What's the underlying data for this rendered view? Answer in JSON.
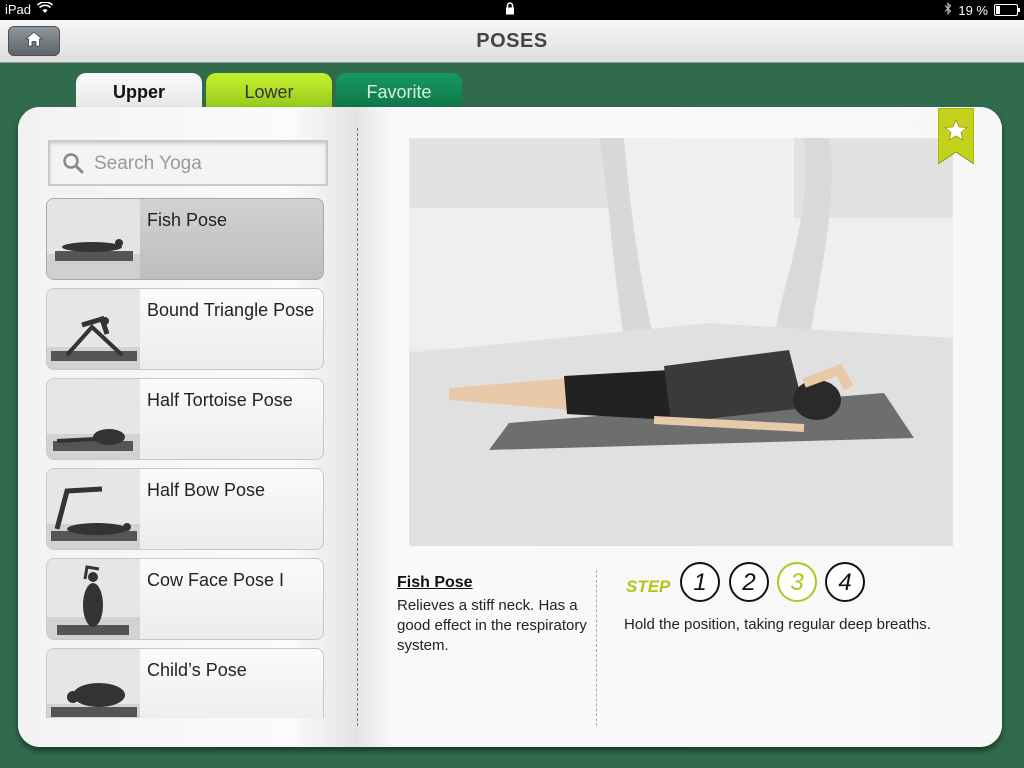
{
  "status_bar": {
    "device": "iPad",
    "battery_percent": "19 %",
    "battery_level": 0.19,
    "icons": [
      "wifi-icon",
      "lock-icon",
      "bluetooth-icon",
      "battery-icon"
    ]
  },
  "nav": {
    "title": "POSES",
    "home_icon": "home-icon"
  },
  "tabs": [
    {
      "label": "Upper",
      "active": true,
      "color": "#f2f2f2"
    },
    {
      "label": "Lower",
      "active": false,
      "color": "#b2e026"
    },
    {
      "label": "Favorite",
      "active": false,
      "color": "#138a58"
    }
  ],
  "search": {
    "placeholder": "Search Yoga",
    "value": ""
  },
  "poses": [
    {
      "label": "Fish Pose",
      "selected": true
    },
    {
      "label": "Bound Triangle Pose",
      "selected": false
    },
    {
      "label": "Half Tortoise Pose",
      "selected": false
    },
    {
      "label": "Half Bow Pose",
      "selected": false
    },
    {
      "label": "Cow Face Pose I",
      "selected": false
    },
    {
      "label": "Child’s Pose",
      "selected": false
    }
  ],
  "detail": {
    "name": "Fish Pose",
    "description": "Relieves a stiff neck. Has a good effect in the respiratory system.",
    "step_label": "STEP",
    "steps": [
      "1",
      "2",
      "3",
      "4"
    ],
    "active_step": "3",
    "step_instruction": "Hold the position, taking regular deep breaths.",
    "favorite_icon": "star-bookmark-icon"
  },
  "colors": {
    "accent": "#b4c51a",
    "background": "#2f6b4c",
    "lower_tab": "#b2e026",
    "favorite_tab": "#138a58"
  }
}
